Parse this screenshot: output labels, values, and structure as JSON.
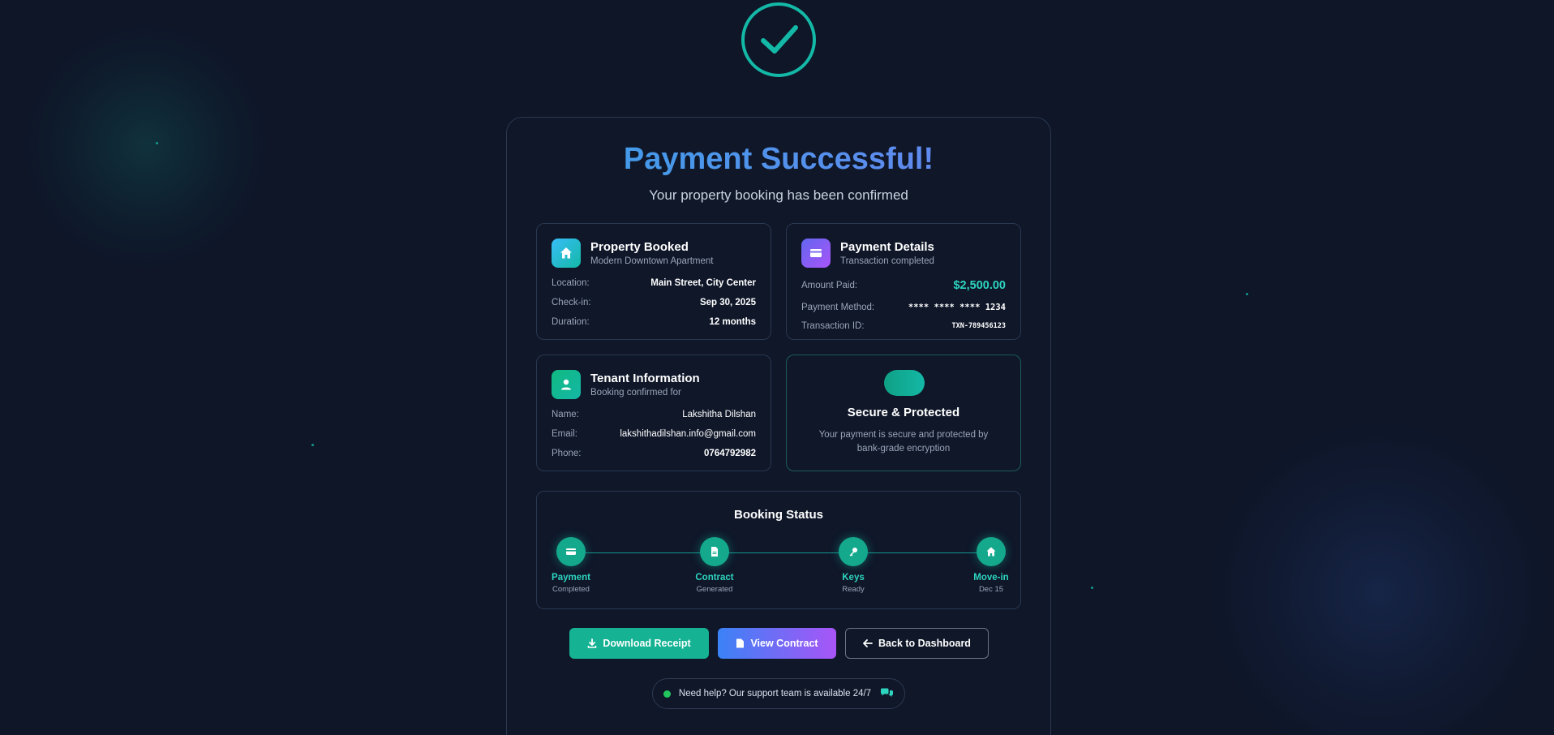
{
  "header": {
    "title": "Payment Successful!",
    "subtitle": "Your property booking has been confirmed"
  },
  "property": {
    "title": "Property Booked",
    "subtitle": "Modern Downtown Apartment",
    "rows": [
      {
        "label": "Location:",
        "value": "Main Street, City Center"
      },
      {
        "label": "Check-in:",
        "value": "Sep 30, 2025"
      },
      {
        "label": "Duration:",
        "value": "12 months"
      }
    ]
  },
  "payment": {
    "title": "Payment Details",
    "subtitle": "Transaction completed",
    "amount_label": "Amount Paid:",
    "amount_value": "$2,500.00",
    "method_label": "Payment Method:",
    "method_value": "**** **** **** 1234",
    "txn_label": "Transaction ID:",
    "txn_value": "TXN-789456123"
  },
  "tenant": {
    "title": "Tenant Information",
    "subtitle": "Booking confirmed for",
    "rows": [
      {
        "label": "Name:",
        "value": "Lakshitha Dilshan"
      },
      {
        "label": "Email:",
        "value": "lakshithadilshan.info@gmail.com"
      },
      {
        "label": "Phone:",
        "value": "0764792982"
      }
    ]
  },
  "secure": {
    "title": "Secure & Protected",
    "text": "Your payment is secure and protected by bank-grade encryption"
  },
  "booking_status": {
    "title": "Booking Status",
    "steps": [
      {
        "label": "Payment",
        "sub": "Completed",
        "icon": "card-icon"
      },
      {
        "label": "Contract",
        "sub": "Generated",
        "icon": "document-icon"
      },
      {
        "label": "Keys",
        "sub": "Ready",
        "icon": "key-icon"
      },
      {
        "label": "Move-in",
        "sub": "Dec 15",
        "icon": "home-icon"
      }
    ]
  },
  "actions": {
    "download_receipt": "Download Receipt",
    "view_contract": "View Contract",
    "back_to_dashboard": "Back to Dashboard"
  },
  "help": {
    "text": "Need help? Our support team is available 24/7"
  },
  "colors": {
    "background": "#0e1628",
    "accent_teal": "#14b8a6",
    "title_gradient_start": "#3aa0e8",
    "title_gradient_end": "#6a84f0",
    "amount": "#2dd4bf"
  }
}
